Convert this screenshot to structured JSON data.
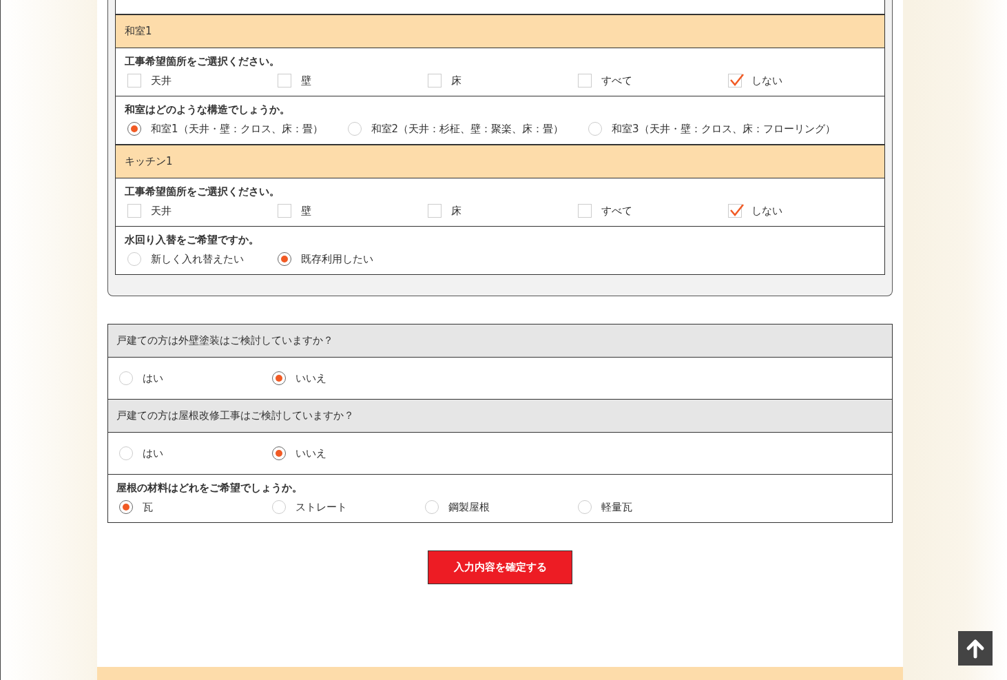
{
  "rooms_table": [
    {
      "kind": "section",
      "text": "和室1"
    },
    {
      "kind": "checkbox",
      "prompt": "工事希望箇所をご選択ください。",
      "options": [
        {
          "label": "天井",
          "checked": false
        },
        {
          "label": "壁",
          "checked": false
        },
        {
          "label": "床",
          "checked": false
        },
        {
          "label": "すべて",
          "checked": false
        },
        {
          "label": "しない",
          "checked": true
        }
      ]
    },
    {
      "kind": "radio",
      "prompt": "和室はどのような構造でしょうか。",
      "options": [
        {
          "label": "和室1（天井・壁：クロス、床：畳）",
          "selected": true
        },
        {
          "label": "和室2（天井：杉柾、壁：聚楽、床：畳）",
          "selected": false
        },
        {
          "label": "和室3（天井・壁：クロス、床：フローリング）",
          "selected": false
        }
      ]
    },
    {
      "kind": "section",
      "text": "キッチン1"
    },
    {
      "kind": "checkbox",
      "prompt": "工事希望箇所をご選択ください。",
      "options": [
        {
          "label": "天井",
          "checked": false
        },
        {
          "label": "壁",
          "checked": false
        },
        {
          "label": "床",
          "checked": false
        },
        {
          "label": "すべて",
          "checked": false
        },
        {
          "label": "しない",
          "checked": true
        }
      ]
    },
    {
      "kind": "radio",
      "prompt": "水回り入替をご希望ですか。",
      "options": [
        {
          "label": "新しく入れ替えたい",
          "selected": false
        },
        {
          "label": "既存利用したい",
          "selected": true
        }
      ]
    }
  ],
  "house_table": [
    {
      "kind": "banner",
      "text": "戸建ての方は外壁塗装はご検討していますか？"
    },
    {
      "kind": "radio",
      "options": [
        {
          "label": "はい",
          "selected": false
        },
        {
          "label": "いいえ",
          "selected": true
        }
      ]
    },
    {
      "kind": "banner",
      "text": "戸建ての方は屋根改修工事はご検討していますか？"
    },
    {
      "kind": "radio",
      "options": [
        {
          "label": "はい",
          "selected": false
        },
        {
          "label": "いいえ",
          "selected": true
        }
      ]
    },
    {
      "kind": "radio",
      "prompt": "屋根の材料はどれをご希望でしょうか。",
      "options": [
        {
          "label": "瓦",
          "selected": true
        },
        {
          "label": "ストレート",
          "selected": false
        },
        {
          "label": "鋼製屋根",
          "selected": false
        },
        {
          "label": "軽量瓦",
          "selected": false
        }
      ]
    }
  ],
  "submit_button": "入力内容を確定する"
}
